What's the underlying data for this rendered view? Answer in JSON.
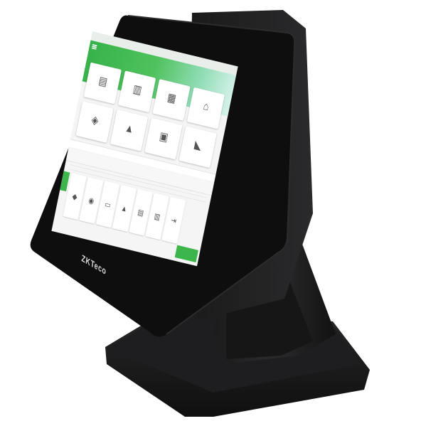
{
  "device": {
    "brand": "ZKTeco",
    "colors": {
      "body": "#161617",
      "screen_bezel": "#0d0d0e",
      "accent_green": "#3cb54a"
    }
  },
  "screen": {
    "app_title": "",
    "clock": "",
    "main_tiles": [
      {
        "icon": "register-icon",
        "glyph": "▤",
        "label": ""
      },
      {
        "icon": "receipt-icon",
        "glyph": "▥",
        "label": ""
      },
      {
        "icon": "inventory-icon",
        "glyph": "▦",
        "label": ""
      },
      {
        "icon": "customer-icon",
        "glyph": "⌂",
        "label": ""
      },
      {
        "icon": "promotion-icon",
        "glyph": "◈",
        "label": ""
      },
      {
        "icon": "report-icon",
        "glyph": "▲",
        "label": ""
      },
      {
        "icon": "settings-icon",
        "glyph": "▣",
        "label": ""
      },
      {
        "icon": "announcement-icon",
        "glyph": "◣",
        "label": ""
      }
    ],
    "bottom_tiles": [
      {
        "icon": "cart-icon",
        "glyph": "◆"
      },
      {
        "icon": "user-icon",
        "glyph": "◉"
      },
      {
        "icon": "card-icon",
        "glyph": "▭"
      },
      {
        "icon": "store-icon",
        "glyph": "▲"
      },
      {
        "icon": "list-icon",
        "glyph": "▤"
      },
      {
        "icon": "print-icon",
        "glyph": "▥"
      },
      {
        "icon": "logout-icon",
        "glyph": "⇥"
      }
    ]
  }
}
